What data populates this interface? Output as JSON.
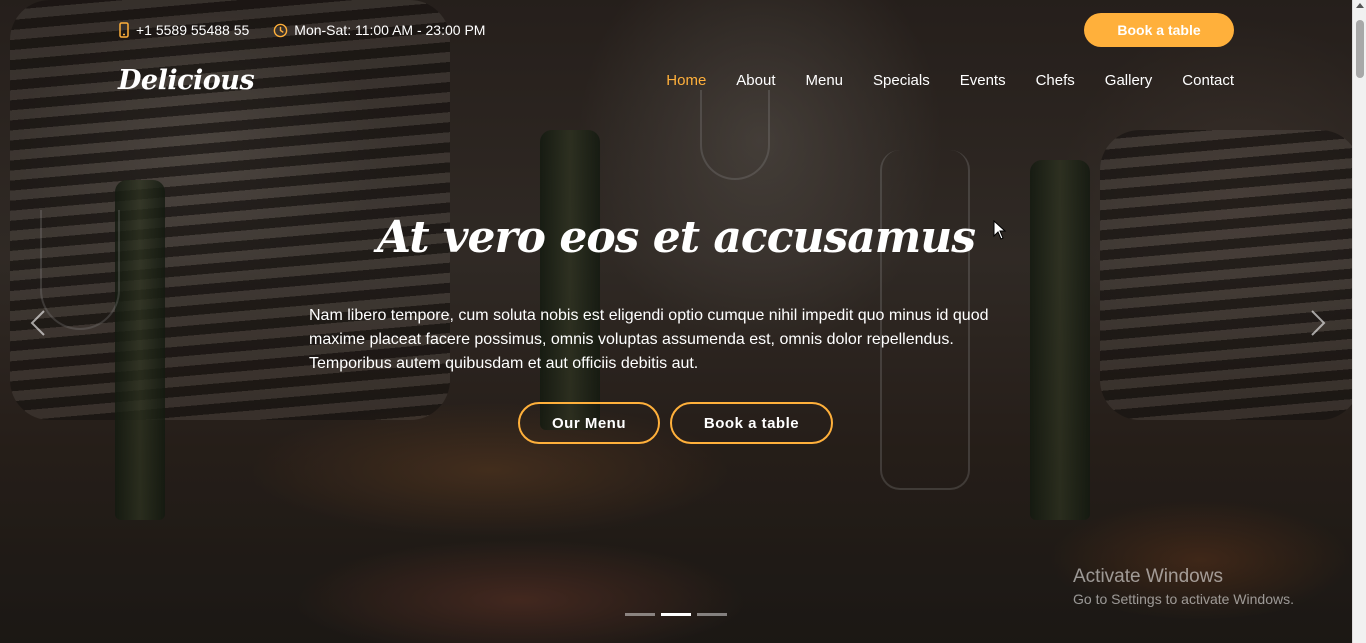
{
  "topbar": {
    "phone_icon": "phone-icon",
    "phone": "+1 5589 55488 55",
    "clock_icon": "clock-icon",
    "hours": "Mon-Sat: 11:00 AM - 23:00 PM",
    "book_button": "Book a table"
  },
  "navbar": {
    "logo": "Delicious",
    "items": [
      {
        "label": "Home",
        "active": true
      },
      {
        "label": "About"
      },
      {
        "label": "Menu"
      },
      {
        "label": "Specials"
      },
      {
        "label": "Events"
      },
      {
        "label": "Chefs"
      },
      {
        "label": "Gallery"
      },
      {
        "label": "Contact"
      }
    ]
  },
  "hero": {
    "title": "At vero eos et accusamus",
    "text": "Nam libero tempore, cum soluta nobis est eligendi optio cumque nihil impedit quo minus id quod maxime placeat facere possimus, omnis voluptas assumenda est, omnis dolor repellendus. Temporibus autem quibusdam et aut officiis debitis aut.",
    "menu_button": "Our Menu",
    "book_button": "Book a table",
    "prev_icon": "chevron-left-icon",
    "next_icon": "chevron-right-icon",
    "slide_count": 3,
    "active_slide": 2
  },
  "watermark": {
    "title": "Activate Windows",
    "subtitle": "Go to Settings to activate Windows."
  },
  "colors": {
    "accent": "#ffb03b"
  }
}
